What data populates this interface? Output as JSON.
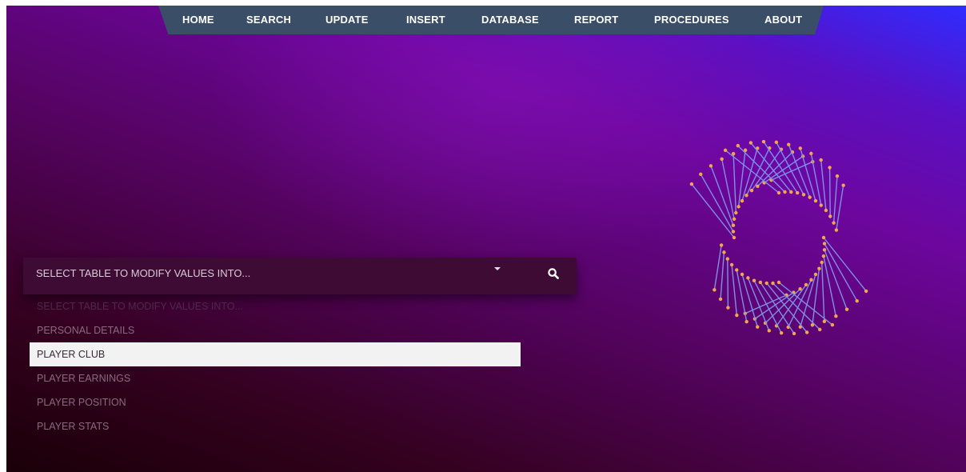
{
  "nav": {
    "items": [
      "HOME",
      "SEARCH",
      "UPDATE",
      "INSERT",
      "DATABASE",
      "REPORT",
      "PROCEDURES",
      "ABOUT"
    ]
  },
  "select": {
    "value": "SELECT TABLE TO MODIFY VALUES INTO..."
  },
  "dropdown": {
    "options": [
      "SELECT TABLE TO MODIFY VALUES INTO...",
      "PERSONAL DETAILS",
      "PLAYER CLUB",
      "PLAYER EARNINGS",
      "PLAYER POSITION",
      "PLAYER STATS"
    ],
    "selected": "PLAYER CLUB"
  },
  "colors": {
    "navbar": "#3a4e68",
    "line": "#7f8fe6",
    "dot": "#f4a64a"
  },
  "icons": {
    "search": "search-icon",
    "caret": "caret-down-icon"
  }
}
